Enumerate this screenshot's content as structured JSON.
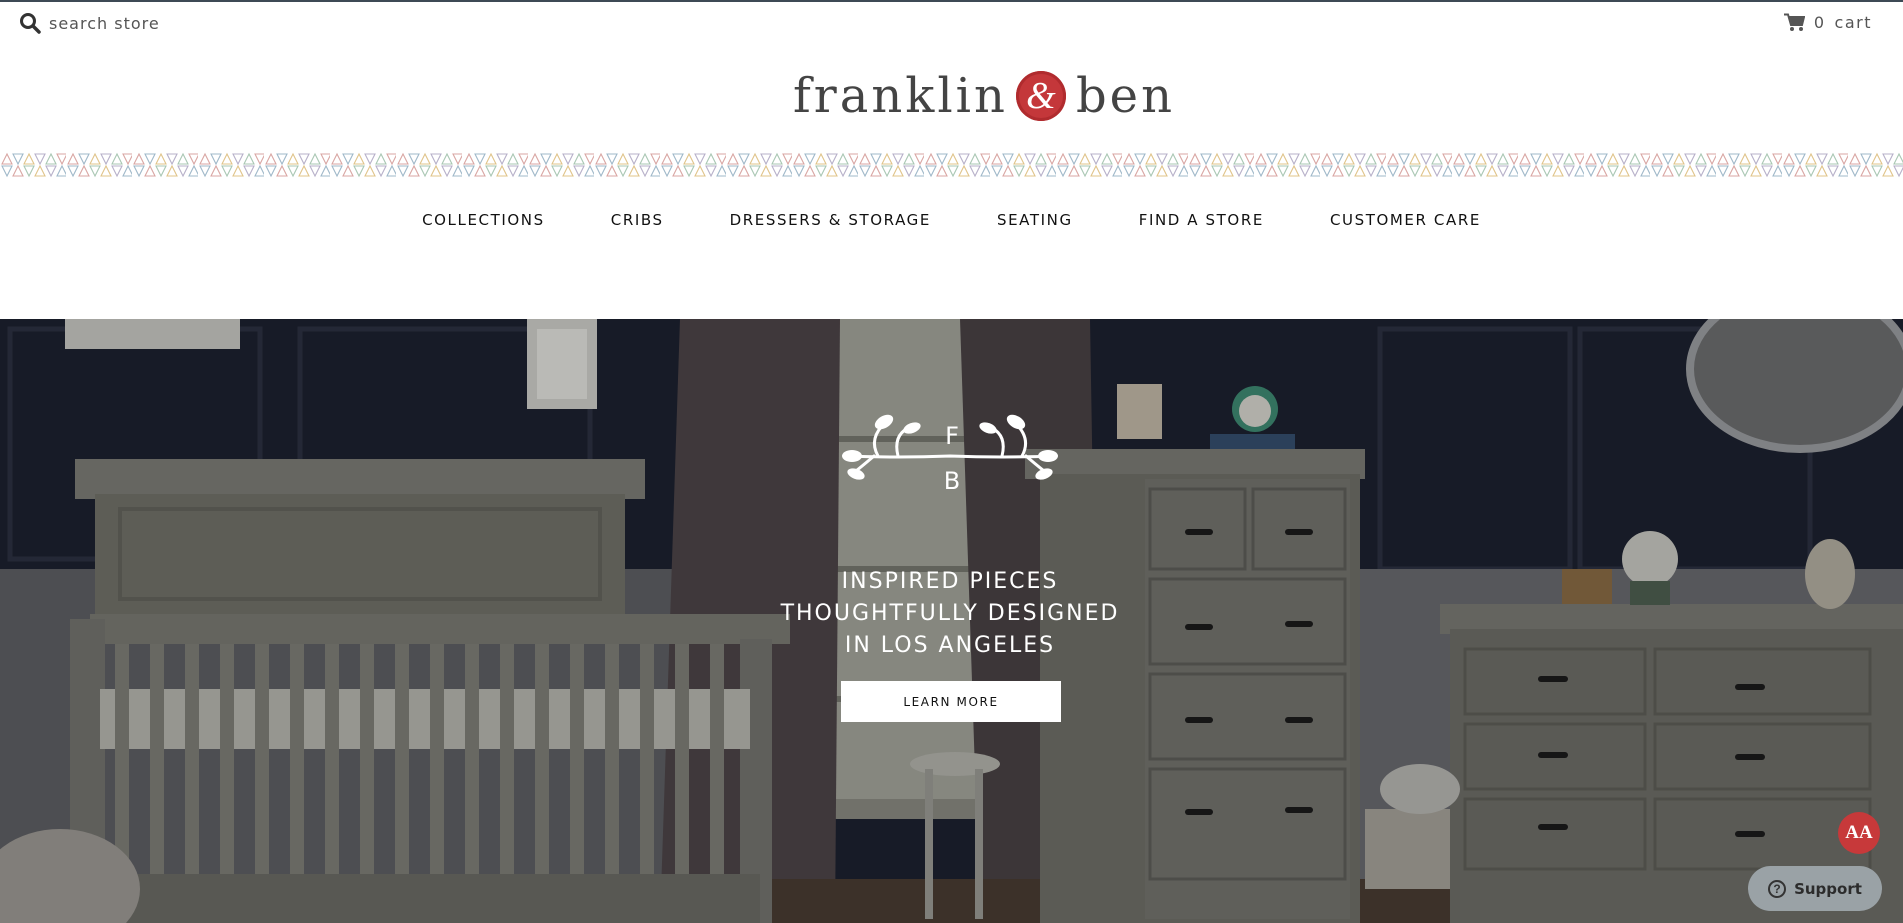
{
  "header": {
    "search": {
      "placeholder": "search store",
      "icon": "search-icon"
    },
    "cart": {
      "count": "0",
      "label": "cart",
      "icon": "cart-icon"
    },
    "logo": {
      "word1": "franklin",
      "ampersand": "&",
      "word2": "ben"
    }
  },
  "nav": {
    "items": [
      {
        "label": "COLLECTIONS"
      },
      {
        "label": "CRIBS"
      },
      {
        "label": "DRESSERS & STORAGE"
      },
      {
        "label": "SEATING"
      },
      {
        "label": "FIND A STORE"
      },
      {
        "label": "CUSTOMER CARE"
      }
    ]
  },
  "hero": {
    "monogram_top": "F",
    "monogram_bottom": "B",
    "tagline": [
      "INSPIRED PIECES",
      "THOUGHTFULLY DESIGNED",
      "IN LOS ANGELES"
    ],
    "button_label": "LEARN MORE"
  },
  "widgets": {
    "accessibility_label": "AA",
    "support_label": "Support",
    "support_icon_glyph": "?"
  },
  "colors": {
    "brand_red": "#c4373a",
    "top_border": "#3d4a55",
    "hero_wall": "#1c1f2a",
    "support_bg": "#9aa2a6"
  }
}
